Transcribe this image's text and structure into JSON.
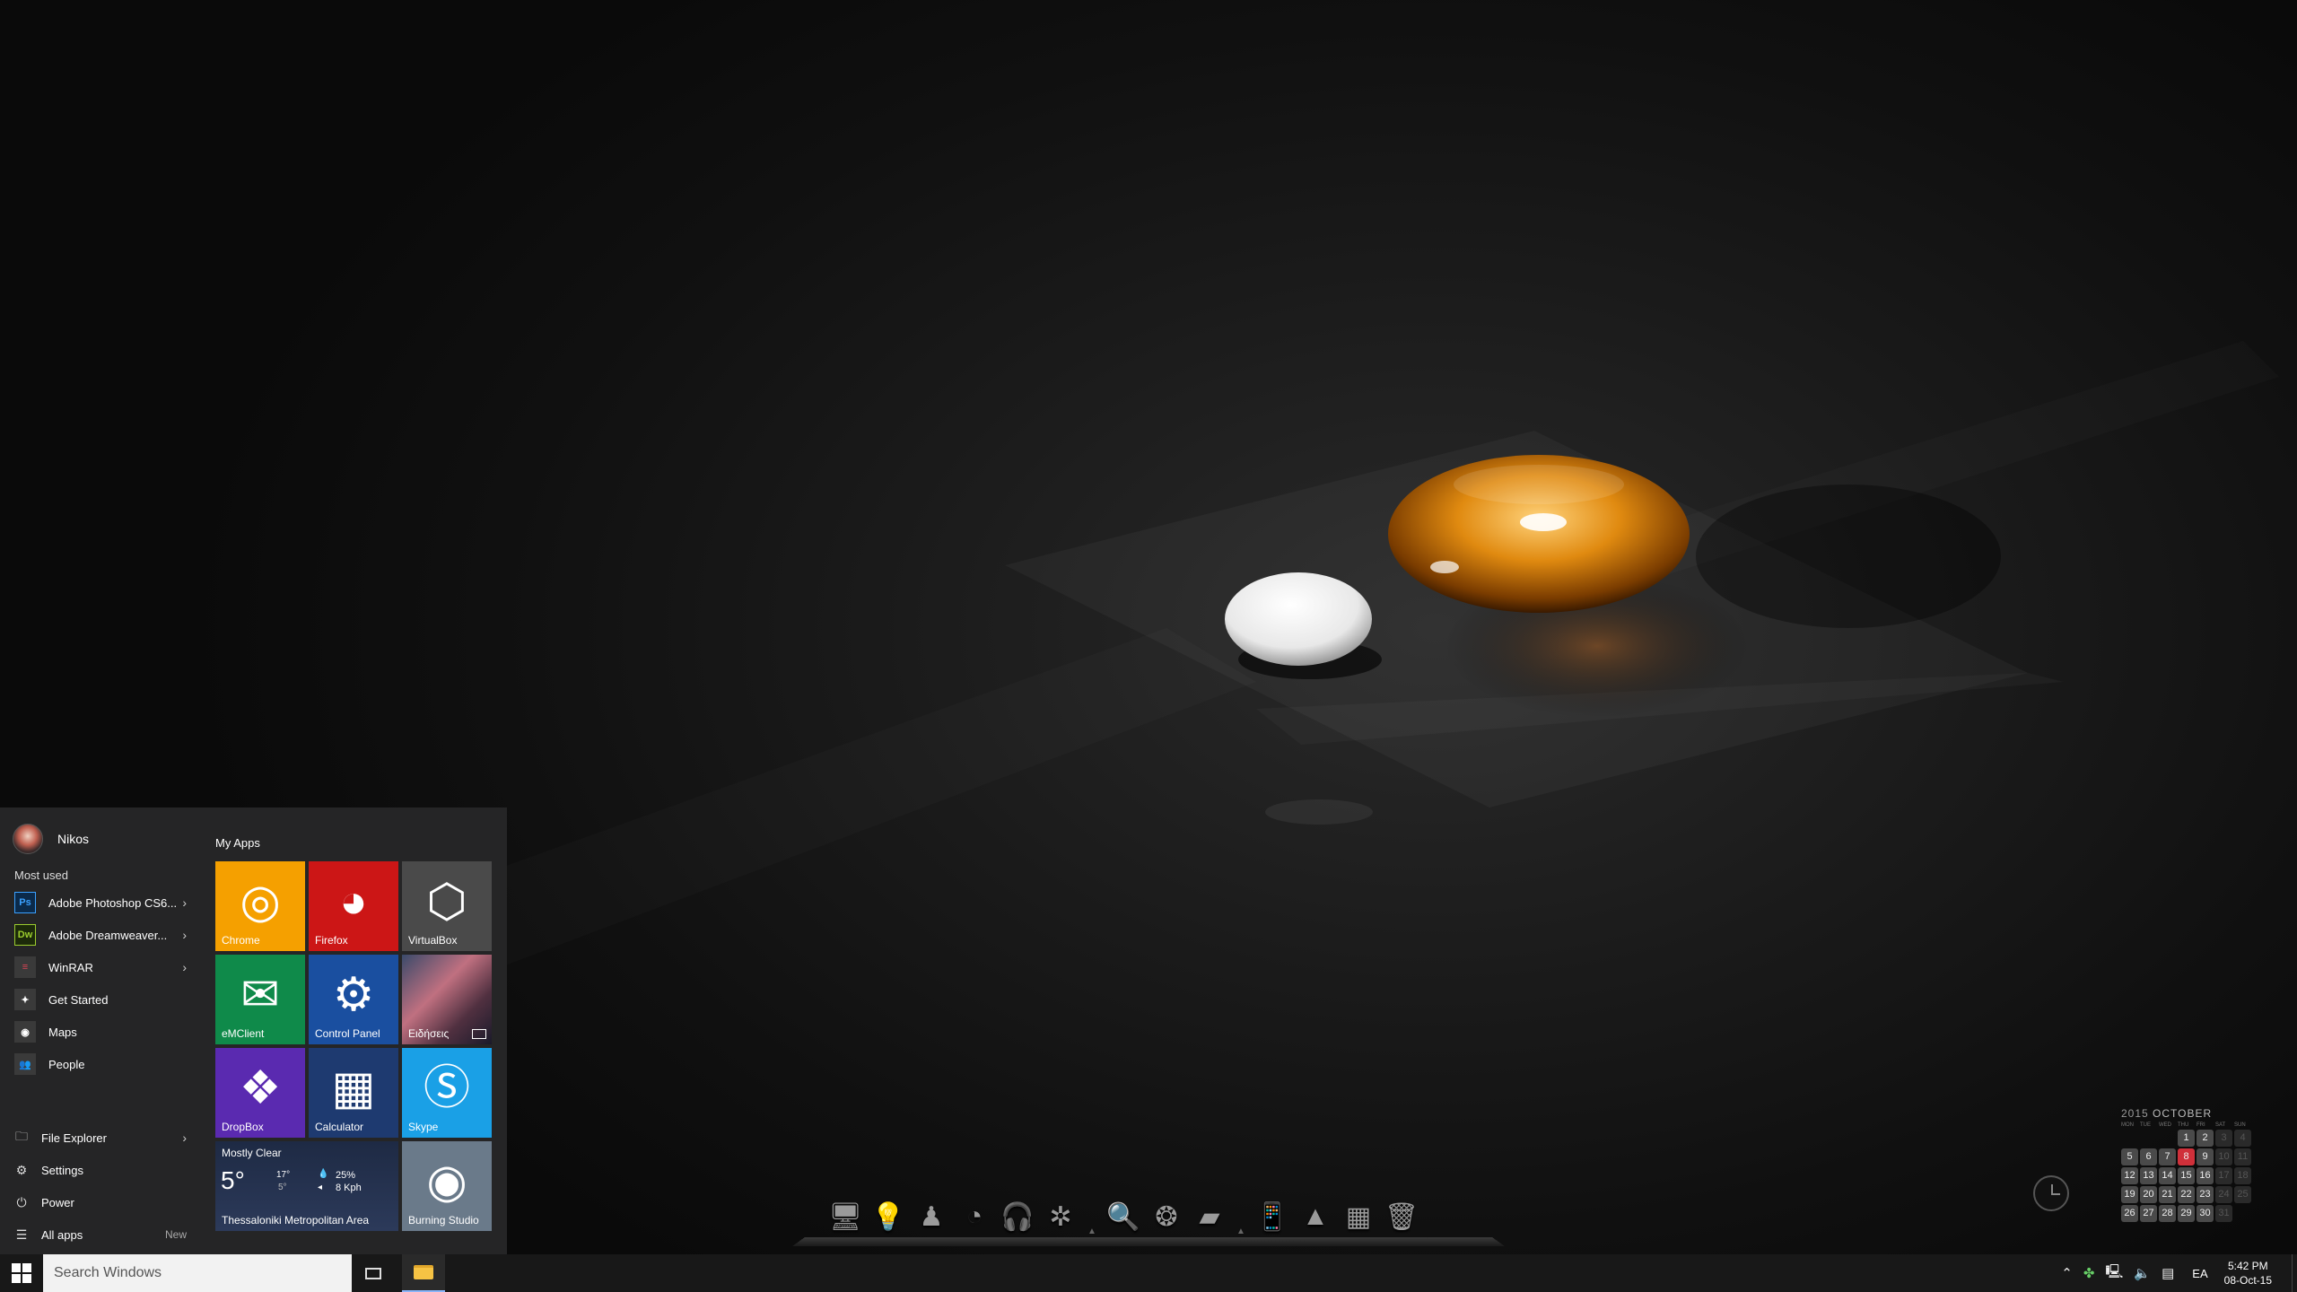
{
  "start_menu": {
    "user_name": "Nikos",
    "most_used_label": "Most used",
    "apps": [
      {
        "label": "Adobe Photoshop CS6...",
        "icon": "Ps",
        "icon_color": "#0b2a4a",
        "icon_text_color": "#3aa0ff",
        "has_arrow": true
      },
      {
        "label": "Adobe Dreamweaver...",
        "icon": "Dw",
        "icon_color": "#1c2a0a",
        "icon_text_color": "#9bcc2e",
        "has_arrow": true
      },
      {
        "label": "WinRAR",
        "icon": "≡",
        "icon_color": "#3a3a3a",
        "icon_text_color": "#d45",
        "has_arrow": true
      },
      {
        "label": "Get Started",
        "icon": "✦",
        "icon_color": "#3a3a3a",
        "icon_text_color": "#fff",
        "has_arrow": false
      },
      {
        "label": "Maps",
        "icon": "◉",
        "icon_color": "#3a3a3a",
        "icon_text_color": "#fff",
        "has_arrow": false
      },
      {
        "label": "People",
        "icon": "👥",
        "icon_color": "#3a3a3a",
        "icon_text_color": "#fff",
        "has_arrow": false
      }
    ],
    "system": [
      {
        "label": "File Explorer",
        "icon": "🗀",
        "has_arrow": true
      },
      {
        "label": "Settings",
        "icon": "⚙",
        "has_arrow": false
      },
      {
        "label": "Power",
        "icon": "⏻",
        "has_arrow": false
      },
      {
        "label": "All apps",
        "icon": "☰",
        "has_arrow": false,
        "badge": "New"
      }
    ],
    "tiles_group": "My Apps",
    "tiles": [
      {
        "label": "Chrome",
        "icon": "◎",
        "color": "#f5a000"
      },
      {
        "label": "Firefox",
        "icon": "◕",
        "color": "#cc1616"
      },
      {
        "label": "VirtualBox",
        "icon": "⬡",
        "color": "#4a4a4a"
      },
      {
        "label": "eMClient",
        "icon": "✉",
        "color": "#0f8a4a"
      },
      {
        "label": "Control Panel",
        "icon": "⚙",
        "color": "#1a4fa0"
      },
      {
        "label": "Ειδήσεις",
        "icon": "",
        "color": "#6a5060"
      },
      {
        "label": "DropBox",
        "icon": "❖",
        "color": "#5a2ab0"
      },
      {
        "label": "Calculator",
        "icon": "▦",
        "color": "#1e3a70"
      },
      {
        "label": "Skype",
        "icon": "Ⓢ",
        "color": "#1aa0e6"
      },
      {
        "label": "Burning Studio",
        "icon": "◉",
        "color": "#6a7a8a"
      }
    ],
    "weather": {
      "condition": "Mostly Clear",
      "temp": "5°",
      "high": "17°",
      "low": "5°",
      "humidity": "25%",
      "wind": "8 Kph",
      "location": "Thessaloniki Metropolitan Area",
      "color": "#25304a"
    }
  },
  "taskbar": {
    "search_placeholder": "Search Windows",
    "language": "EA",
    "time": "5:42 PM",
    "date": "08-Oct-15"
  },
  "dock": {
    "items": [
      "monitor-icon",
      "lightbulb-icon",
      "user-icon",
      "clock-icon",
      "headphones-icon",
      "film-reel-icon",
      "separator",
      "magnifier-icon",
      "bubbles-icon",
      "drive-icon",
      "separator",
      "phone-icon",
      "triangle-icon",
      "calculator-icon",
      "trash-icon"
    ]
  },
  "calendar": {
    "year": "2015",
    "month": "OCTOBER",
    "days_of_week": [
      "MON",
      "TUE",
      "WED",
      "THU",
      "FRI",
      "SAT",
      "SUN"
    ],
    "today": 8,
    "first_weekday_index": 3,
    "days_in_month": 31
  }
}
